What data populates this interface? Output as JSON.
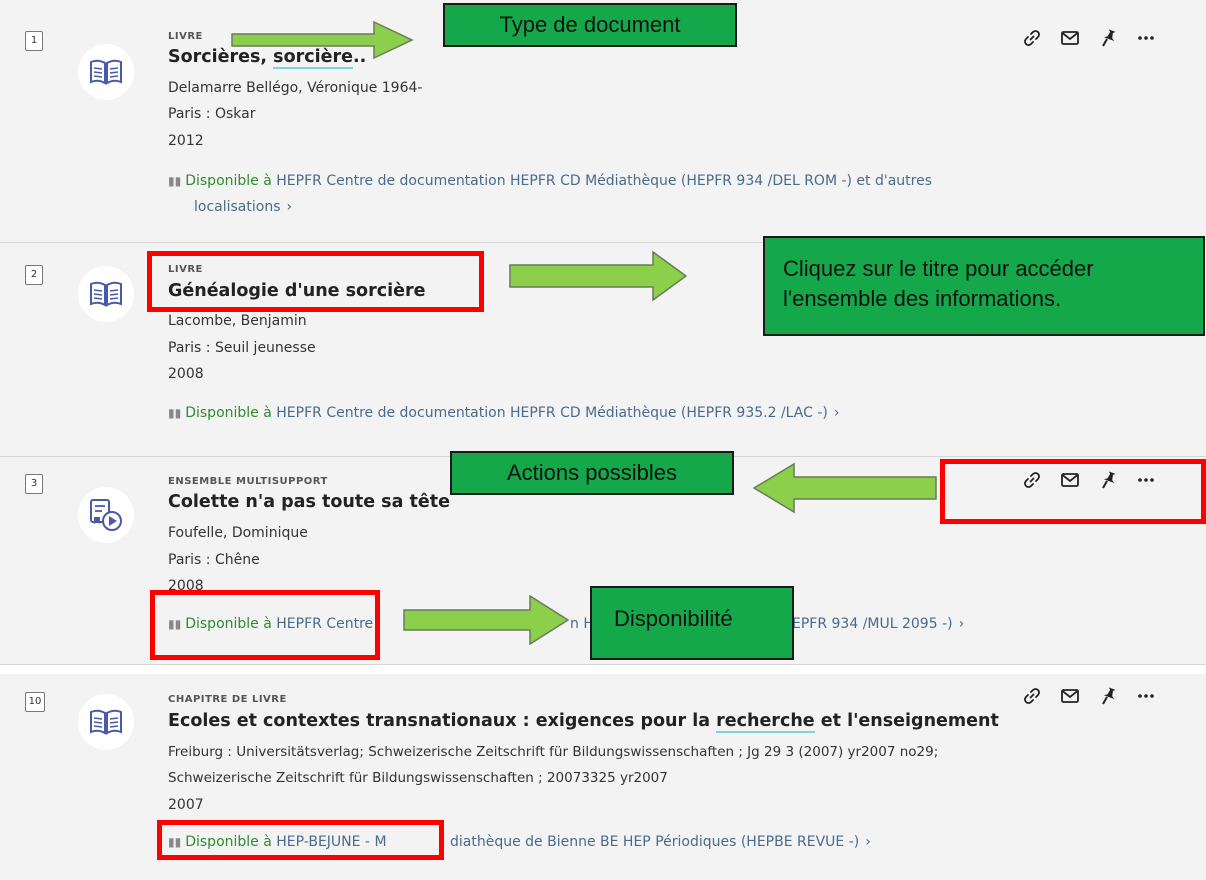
{
  "results": [
    {
      "number": "1",
      "type": "LIVRE",
      "title_before": "Sorcières, ",
      "title_highlight": "sorcière",
      "title_after": "..",
      "author": "Delamarre Bellégo, Véronique 1964-",
      "publisher": "Paris : Oskar",
      "year": "2012",
      "avail_status": "Disponible à",
      "avail_location": "HEPFR Centre de documentation  HEPFR CD Médiathèque (HEPFR 934 /DEL ROM -) et d'autres",
      "avail_location_2": "localisations"
    },
    {
      "number": "2",
      "type": "LIVRE",
      "title": "Généalogie d'une sorcière",
      "author": "Lacombe, Benjamin",
      "publisher": "Paris : Seuil jeunesse",
      "year": "2008",
      "avail_status": "Disponible à",
      "avail_location": "HEPFR Centre de documentation  HEPFR CD Médiathèque (HEPFR 935.2 /LAC -)"
    },
    {
      "number": "3",
      "type": "ENSEMBLE MULTISUPPORT",
      "title": "Colette n'a pas toute sa tête",
      "author": "Foufelle, Dominique",
      "publisher": "Paris : Chêne",
      "year": "2008",
      "avail_status": "Disponible à",
      "avail_location_a": "HEPFR C",
      "avail_location_b": "entre",
      "avail_location_c": "n  H",
      "avail_location_d": "EPFR 934 /MUL 2095 -)"
    },
    {
      "number": "10",
      "type": "CHAPITRE DE LIVRE",
      "title_before": "Ecoles et contextes transnationaux : exigences pour la ",
      "title_highlight": "recherche",
      "title_after": " et l'enseignement",
      "line1": "Freiburg : Universitätsverlag; Schweizerische Zeitschrift für Bildungswissenschaften ; Jg 29 3 (2007) yr2007 no29;",
      "line2": "Schweizerische Zeitschrift für Bildungswissenschaften ; 20073325 yr2007",
      "year": "2007",
      "avail_status": "Disponible à",
      "avail_location_a": "HEP-BEJUNE - M",
      "avail_location_b": "diathèque de Bienne  BE HEP Périodiques (HEPBE REVUE -)"
    }
  ],
  "actions": {
    "link_icon": "link-icon",
    "email_icon": "envelope-icon",
    "pin_icon": "pushpin-icon",
    "more_icon": "ellipsis-icon"
  },
  "annotations": {
    "type_document": "Type de document",
    "click_title_1": "Cliquez sur le titre pour accéder",
    "click_title_2": "l'ensemble des informations.",
    "actions_possibles": "Actions possibles",
    "disponibilite": "Disponibilité"
  },
  "colors": {
    "annotation_green": "#14a84a",
    "highlight_red": "#ff0000",
    "arrow_green": "#8ccf4a",
    "available_green": "#2e8b2e"
  }
}
